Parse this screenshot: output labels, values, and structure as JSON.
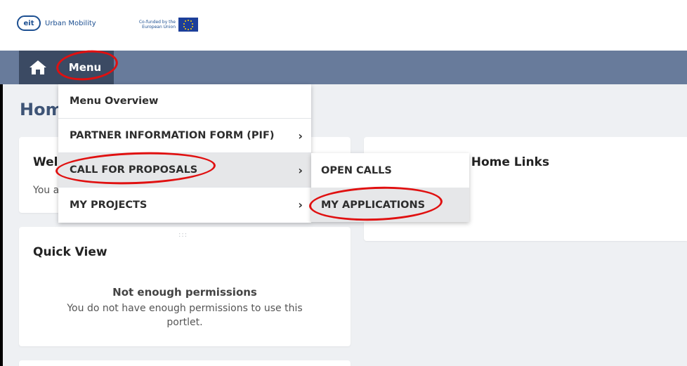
{
  "header": {
    "logo_text": "eit",
    "brand": "Urban Mobility",
    "eu_label": "Co-funded by the European Union"
  },
  "nav": {
    "menu_label": "Menu",
    "home_icon": "home-icon"
  },
  "page": {
    "title": "Home"
  },
  "cards": {
    "welcome_title": "Welcome",
    "welcome_text": "You are",
    "home_links_title": "Help Centre - Home Links",
    "quick_view_title": "Quick View",
    "quick_view_grip": ":::",
    "perm_title": "Not enough permissions",
    "perm_text": "You do not have enough permissions to use this portlet."
  },
  "menu": {
    "items": [
      {
        "label": "Menu Overview"
      },
      {
        "label": "PARTNER INFORMATION FORM (PIF)",
        "chevron": "›"
      },
      {
        "label": "CALL FOR PROPOSALS",
        "chevron": "›"
      },
      {
        "label": "MY PROJECTS",
        "chevron": "›"
      }
    ]
  },
  "submenu": {
    "items": [
      {
        "label": "OPEN CALLS"
      },
      {
        "label": "MY APPLICATIONS"
      }
    ]
  },
  "colors": {
    "navbar": "#687b9b",
    "nav_dark": "#3b4a63",
    "annotation": "#e01010",
    "title_blue": "#3e5476"
  }
}
